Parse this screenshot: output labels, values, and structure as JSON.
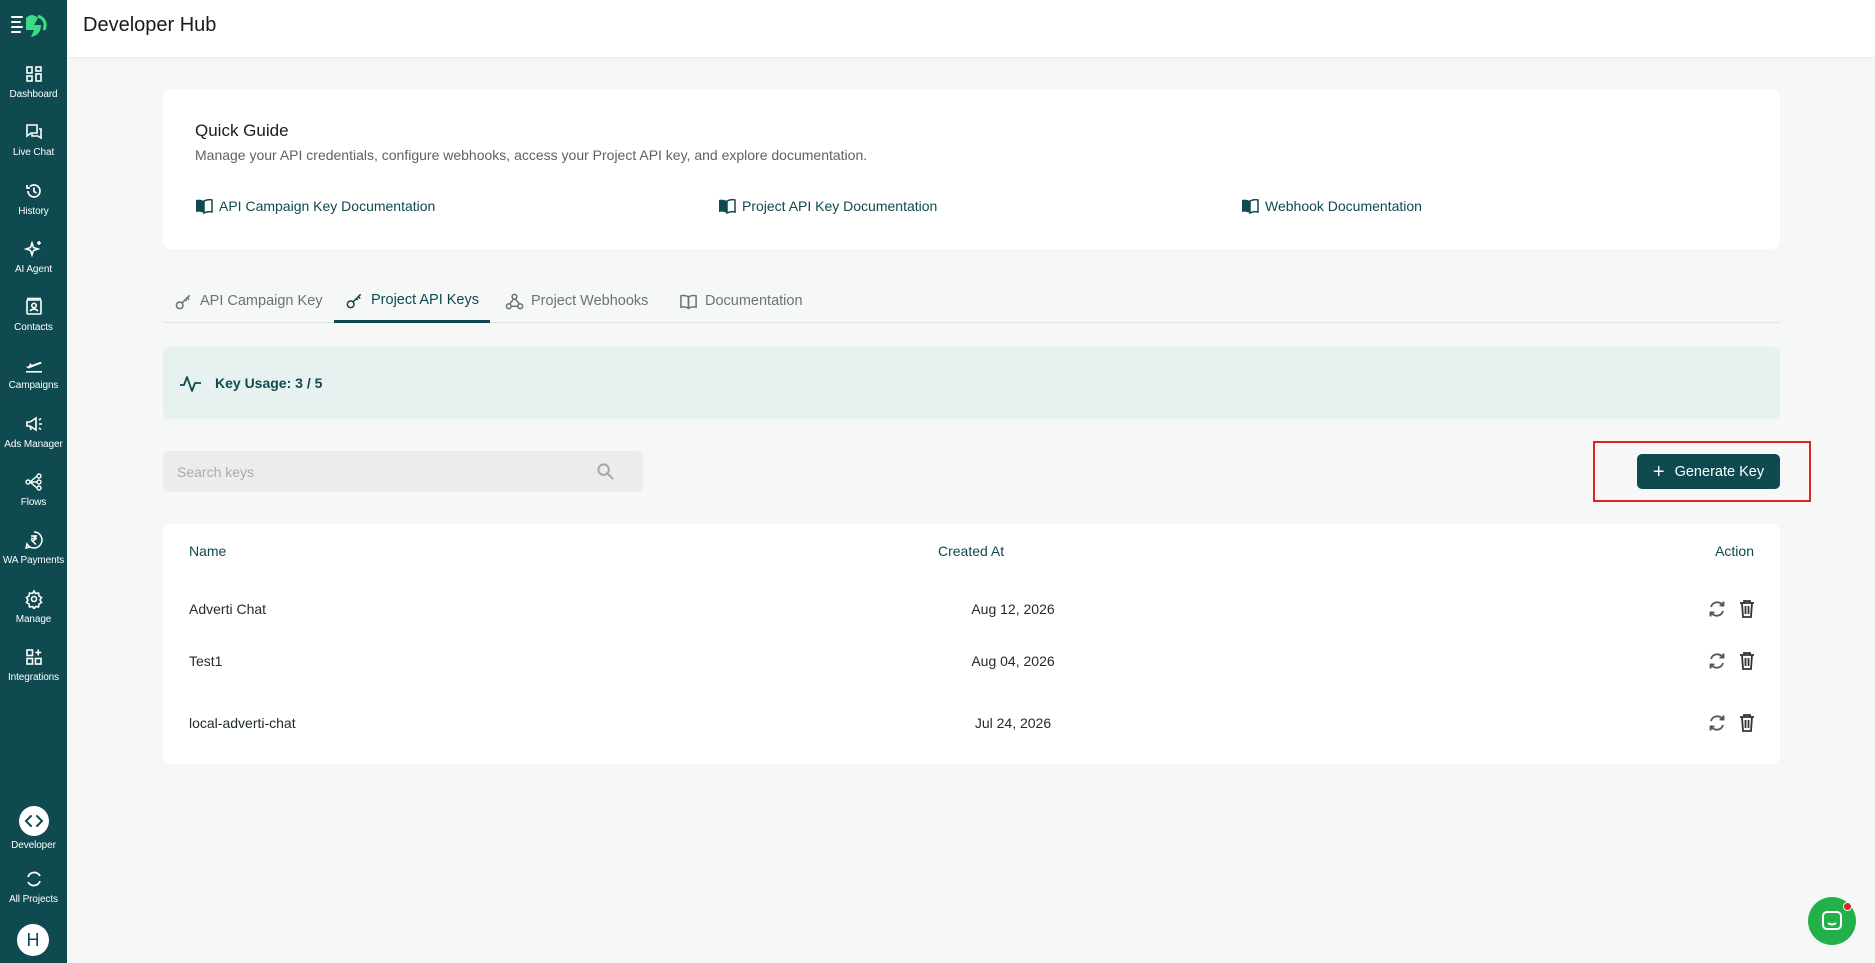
{
  "app": {
    "title": "Developer Hub"
  },
  "sidebar": {
    "items": [
      {
        "label": "Dashboard",
        "icon": "dashboard-icon"
      },
      {
        "label": "Live Chat",
        "icon": "chat-icon"
      },
      {
        "label": "History",
        "icon": "history-icon"
      },
      {
        "label": "AI Agent",
        "icon": "sparkle-icon"
      },
      {
        "label": "Contacts",
        "icon": "contacts-icon"
      },
      {
        "label": "Campaigns",
        "icon": "plane-icon"
      },
      {
        "label": "Ads Manager",
        "icon": "megaphone-icon"
      },
      {
        "label": "Flows",
        "icon": "flow-icon"
      },
      {
        "label": "WA Payments",
        "icon": "rupee-icon"
      },
      {
        "label": "Manage",
        "icon": "gear-icon"
      },
      {
        "label": "Integrations",
        "icon": "integrations-icon"
      }
    ],
    "bottom": [
      {
        "label": "Developer",
        "icon": "code-icon"
      },
      {
        "label": "All Projects",
        "icon": "refresh-icon"
      }
    ],
    "avatar_initial": "H"
  },
  "guide": {
    "title": "Quick Guide",
    "description": "Manage your API credentials, configure webhooks, access your Project API key, and explore documentation.",
    "links": [
      "API Campaign Key Documentation",
      "Project API Key Documentation",
      "Webhook Documentation"
    ]
  },
  "tabs": [
    {
      "label": "API Campaign Key",
      "active": false
    },
    {
      "label": "Project API Keys",
      "active": true
    },
    {
      "label": "Project Webhooks",
      "active": false
    },
    {
      "label": "Documentation",
      "active": false
    }
  ],
  "usage": {
    "label": "Key Usage: 3 / 5"
  },
  "search": {
    "placeholder": "Search keys",
    "value": ""
  },
  "generate_button": {
    "label": "Generate Key"
  },
  "table": {
    "columns": [
      "Name",
      "Created At",
      "Action"
    ],
    "rows": [
      {
        "name": "Adverti Chat",
        "created_at": "Aug 12, 2026"
      },
      {
        "name": "Test1",
        "created_at": "Aug 04, 2026"
      },
      {
        "name": "local-adverti-chat",
        "created_at": "Jul 24, 2026"
      }
    ]
  },
  "colors": {
    "primary": "#0e4a4f",
    "highlight": "#e02424",
    "chat": "#22b04b"
  }
}
